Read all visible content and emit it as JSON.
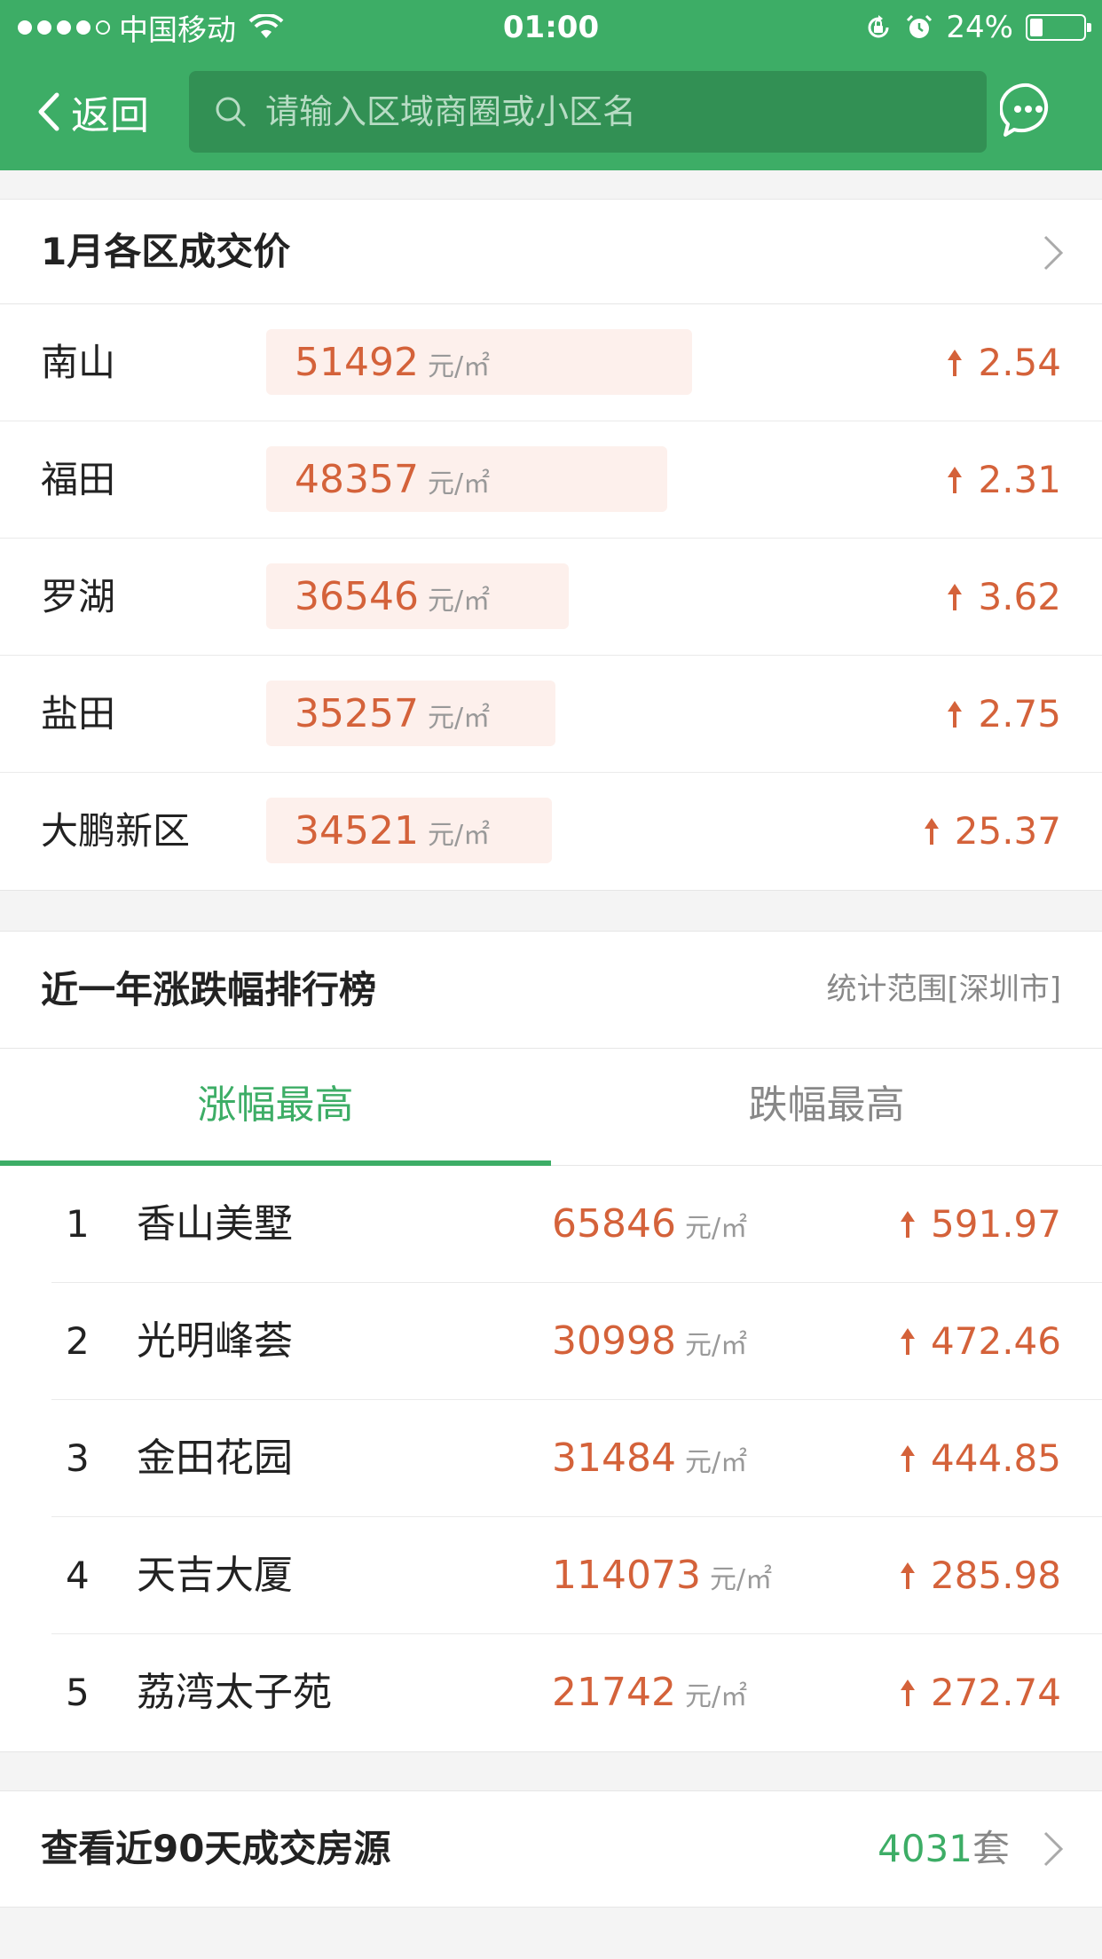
{
  "status_bar": {
    "carrier": "中国移动",
    "time": "01:00",
    "battery": "24%",
    "battery_level": 0.24
  },
  "nav": {
    "back_label": "返回",
    "search_placeholder": "请输入区域商圈或小区名"
  },
  "district_prices": {
    "title": "1月各区成交价",
    "unit": "元/㎡",
    "rows": [
      {
        "name": "南山",
        "price": "51492",
        "change": "2.54"
      },
      {
        "name": "福田",
        "price": "48357",
        "change": "2.31"
      },
      {
        "name": "罗湖",
        "price": "36546",
        "change": "3.62"
      },
      {
        "name": "盐田",
        "price": "35257",
        "change": "2.75"
      },
      {
        "name": "大鹏新区",
        "price": "34521",
        "change": "25.37"
      }
    ]
  },
  "ranking": {
    "title": "近一年涨跌幅排行榜",
    "scope": "统计范围[深圳市]",
    "tabs": [
      {
        "label": "涨幅最高",
        "active": true
      },
      {
        "label": "跌幅最高",
        "active": false
      }
    ],
    "unit": "元/㎡",
    "rows": [
      {
        "rank": "1",
        "name": "香山美墅",
        "price": "65846",
        "change": "591.97"
      },
      {
        "rank": "2",
        "name": "光明峰荟",
        "price": "30998",
        "change": "472.46"
      },
      {
        "rank": "3",
        "name": "金田花园",
        "price": "31484",
        "change": "444.85"
      },
      {
        "rank": "4",
        "name": "天吉大厦",
        "price": "114073",
        "change": "285.98"
      },
      {
        "rank": "5",
        "name": "荔湾太子苑",
        "price": "21742",
        "change": "272.74"
      }
    ]
  },
  "recent_deals": {
    "label": "查看近90天成交房源",
    "count": "4031",
    "count_unit": "套"
  },
  "colors": {
    "brand_green": "#3dad66",
    "price_red": "#d4623a"
  }
}
